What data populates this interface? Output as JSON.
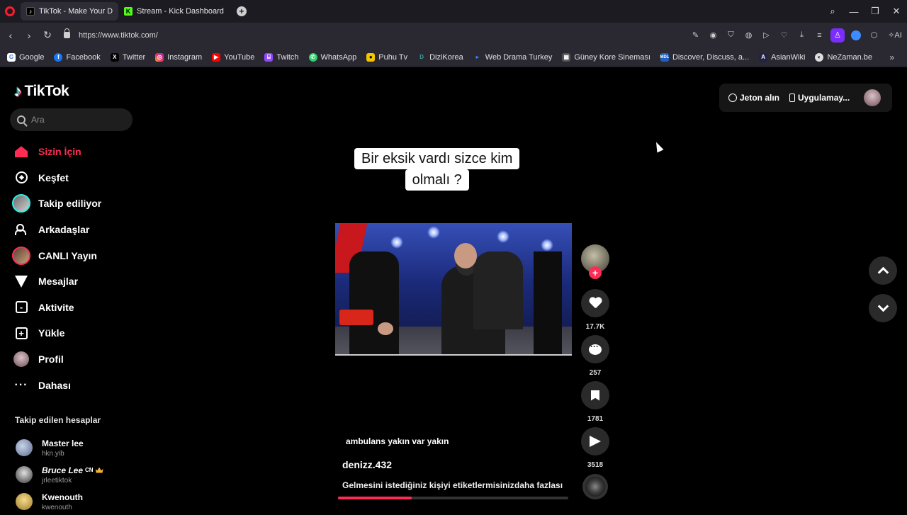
{
  "browser": {
    "tabs": [
      {
        "title": "TikTok - Make Your Da",
        "active": true,
        "icon": "tiktok-favicon"
      },
      {
        "title": "Stream - Kick Dashboard",
        "active": false,
        "icon": "kick-favicon"
      }
    ],
    "url": "https://www.tiktok.com/",
    "ai_label": "AI",
    "bookmarks": [
      {
        "label": "Google",
        "icon": "google-icon",
        "color": "#ffffff"
      },
      {
        "label": "Facebook",
        "icon": "facebook-icon",
        "color": "#1877f2"
      },
      {
        "label": "Twitter",
        "icon": "x-icon",
        "color": "#000000"
      },
      {
        "label": "Instagram",
        "icon": "instagram-icon",
        "color": "#e1306c"
      },
      {
        "label": "YouTube",
        "icon": "youtube-icon",
        "color": "#ff0000"
      },
      {
        "label": "Twitch",
        "icon": "twitch-icon",
        "color": "#9146ff"
      },
      {
        "label": "WhatsApp",
        "icon": "whatsapp-icon",
        "color": "#25d366"
      },
      {
        "label": "Puhu Tv",
        "icon": "puhutv-icon",
        "color": "#f5c400"
      },
      {
        "label": "DiziKorea",
        "icon": "dizikorea-icon",
        "color": "#3aa0a0"
      },
      {
        "label": "Web Drama Turkey",
        "icon": "webdrama-icon",
        "color": "#3b82f6"
      },
      {
        "label": "Güney Kore Sineması",
        "icon": "film-icon",
        "color": "#888888"
      },
      {
        "label": "Discover, Discuss, a...",
        "icon": "mdl-icon",
        "color": "#1f5fbf"
      },
      {
        "label": "AsianWiki",
        "icon": "asianwiki-icon",
        "color": "#222244"
      },
      {
        "label": "NeZaman.be",
        "icon": "nezaman-icon",
        "color": "#dddddd"
      }
    ]
  },
  "tiktok": {
    "logo_text": "TikTok",
    "search_placeholder": "Ara",
    "nav": [
      {
        "label": "Sizin İçin",
        "icon": "home-icon",
        "active": true
      },
      {
        "label": "Keşfet",
        "icon": "compass-icon",
        "active": false
      },
      {
        "label": "Takip ediliyor",
        "icon": "following-avatar-icon",
        "active": false
      },
      {
        "label": "Arkadaşlar",
        "icon": "friends-icon",
        "active": false
      },
      {
        "label": "CANLI Yayın",
        "icon": "live-avatar-icon",
        "active": false
      },
      {
        "label": "Mesajlar",
        "icon": "messages-icon",
        "active": false
      },
      {
        "label": "Aktivite",
        "icon": "activity-icon",
        "active": false
      },
      {
        "label": "Yükle",
        "icon": "upload-icon",
        "active": false
      },
      {
        "label": "Profil",
        "icon": "profile-avatar-icon",
        "active": false
      },
      {
        "label": "Dahası",
        "icon": "more-dots-icon",
        "active": false
      }
    ],
    "following_title": "Takip edilen hesaplar",
    "following": [
      {
        "name": "Master lee",
        "handle": "hkn.yib",
        "badge": "",
        "color": "#8aa0c8"
      },
      {
        "name": "Bruce Lee",
        "handle": "jrleetiktok",
        "badge": "CN",
        "color": "#bbbbbb"
      },
      {
        "name": "Kwenouth",
        "handle": "kwenouth",
        "badge": "",
        "color": "#e0c070"
      }
    ],
    "header": {
      "coins_label": "Jeton alın",
      "app_label": "Uygulamay..."
    },
    "video": {
      "caption_line1": "Bir eksik vardı sizce kim",
      "caption_line2": "olmalı ?",
      "sound_text": "ambulans yakın var yakın",
      "author": "denizz.432",
      "description": "Gelmesini istediğiniz kişiyi etiketlermisiniz",
      "more_label": "daha fazlası",
      "playback_progress": 0.32,
      "likes": "17.7K",
      "comments": "257",
      "saves": "1781",
      "shares": "3518"
    }
  }
}
